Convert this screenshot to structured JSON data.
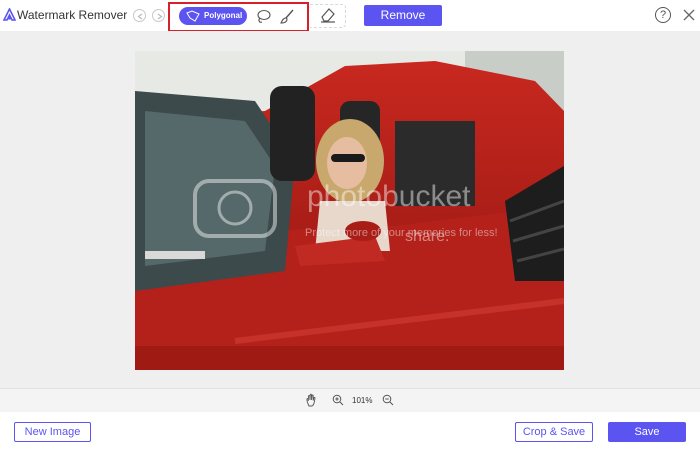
{
  "app": {
    "title": "Watermark Remover"
  },
  "toolbar": {
    "polygonal_label": "Polygonal",
    "remove_label": "Remove",
    "help_label": "?"
  },
  "watermark": {
    "text": "photobucket",
    "subtext": "Protect more of your memories for less!",
    "share_text": "share."
  },
  "zoom": {
    "level": "101%"
  },
  "footer": {
    "new_image_label": "New Image",
    "crop_save_label": "Crop & Save",
    "save_label": "Save"
  },
  "colors": {
    "accent": "#5b54f0",
    "highlight_box": "#d6202a",
    "canvas_bg": "#efefef"
  }
}
